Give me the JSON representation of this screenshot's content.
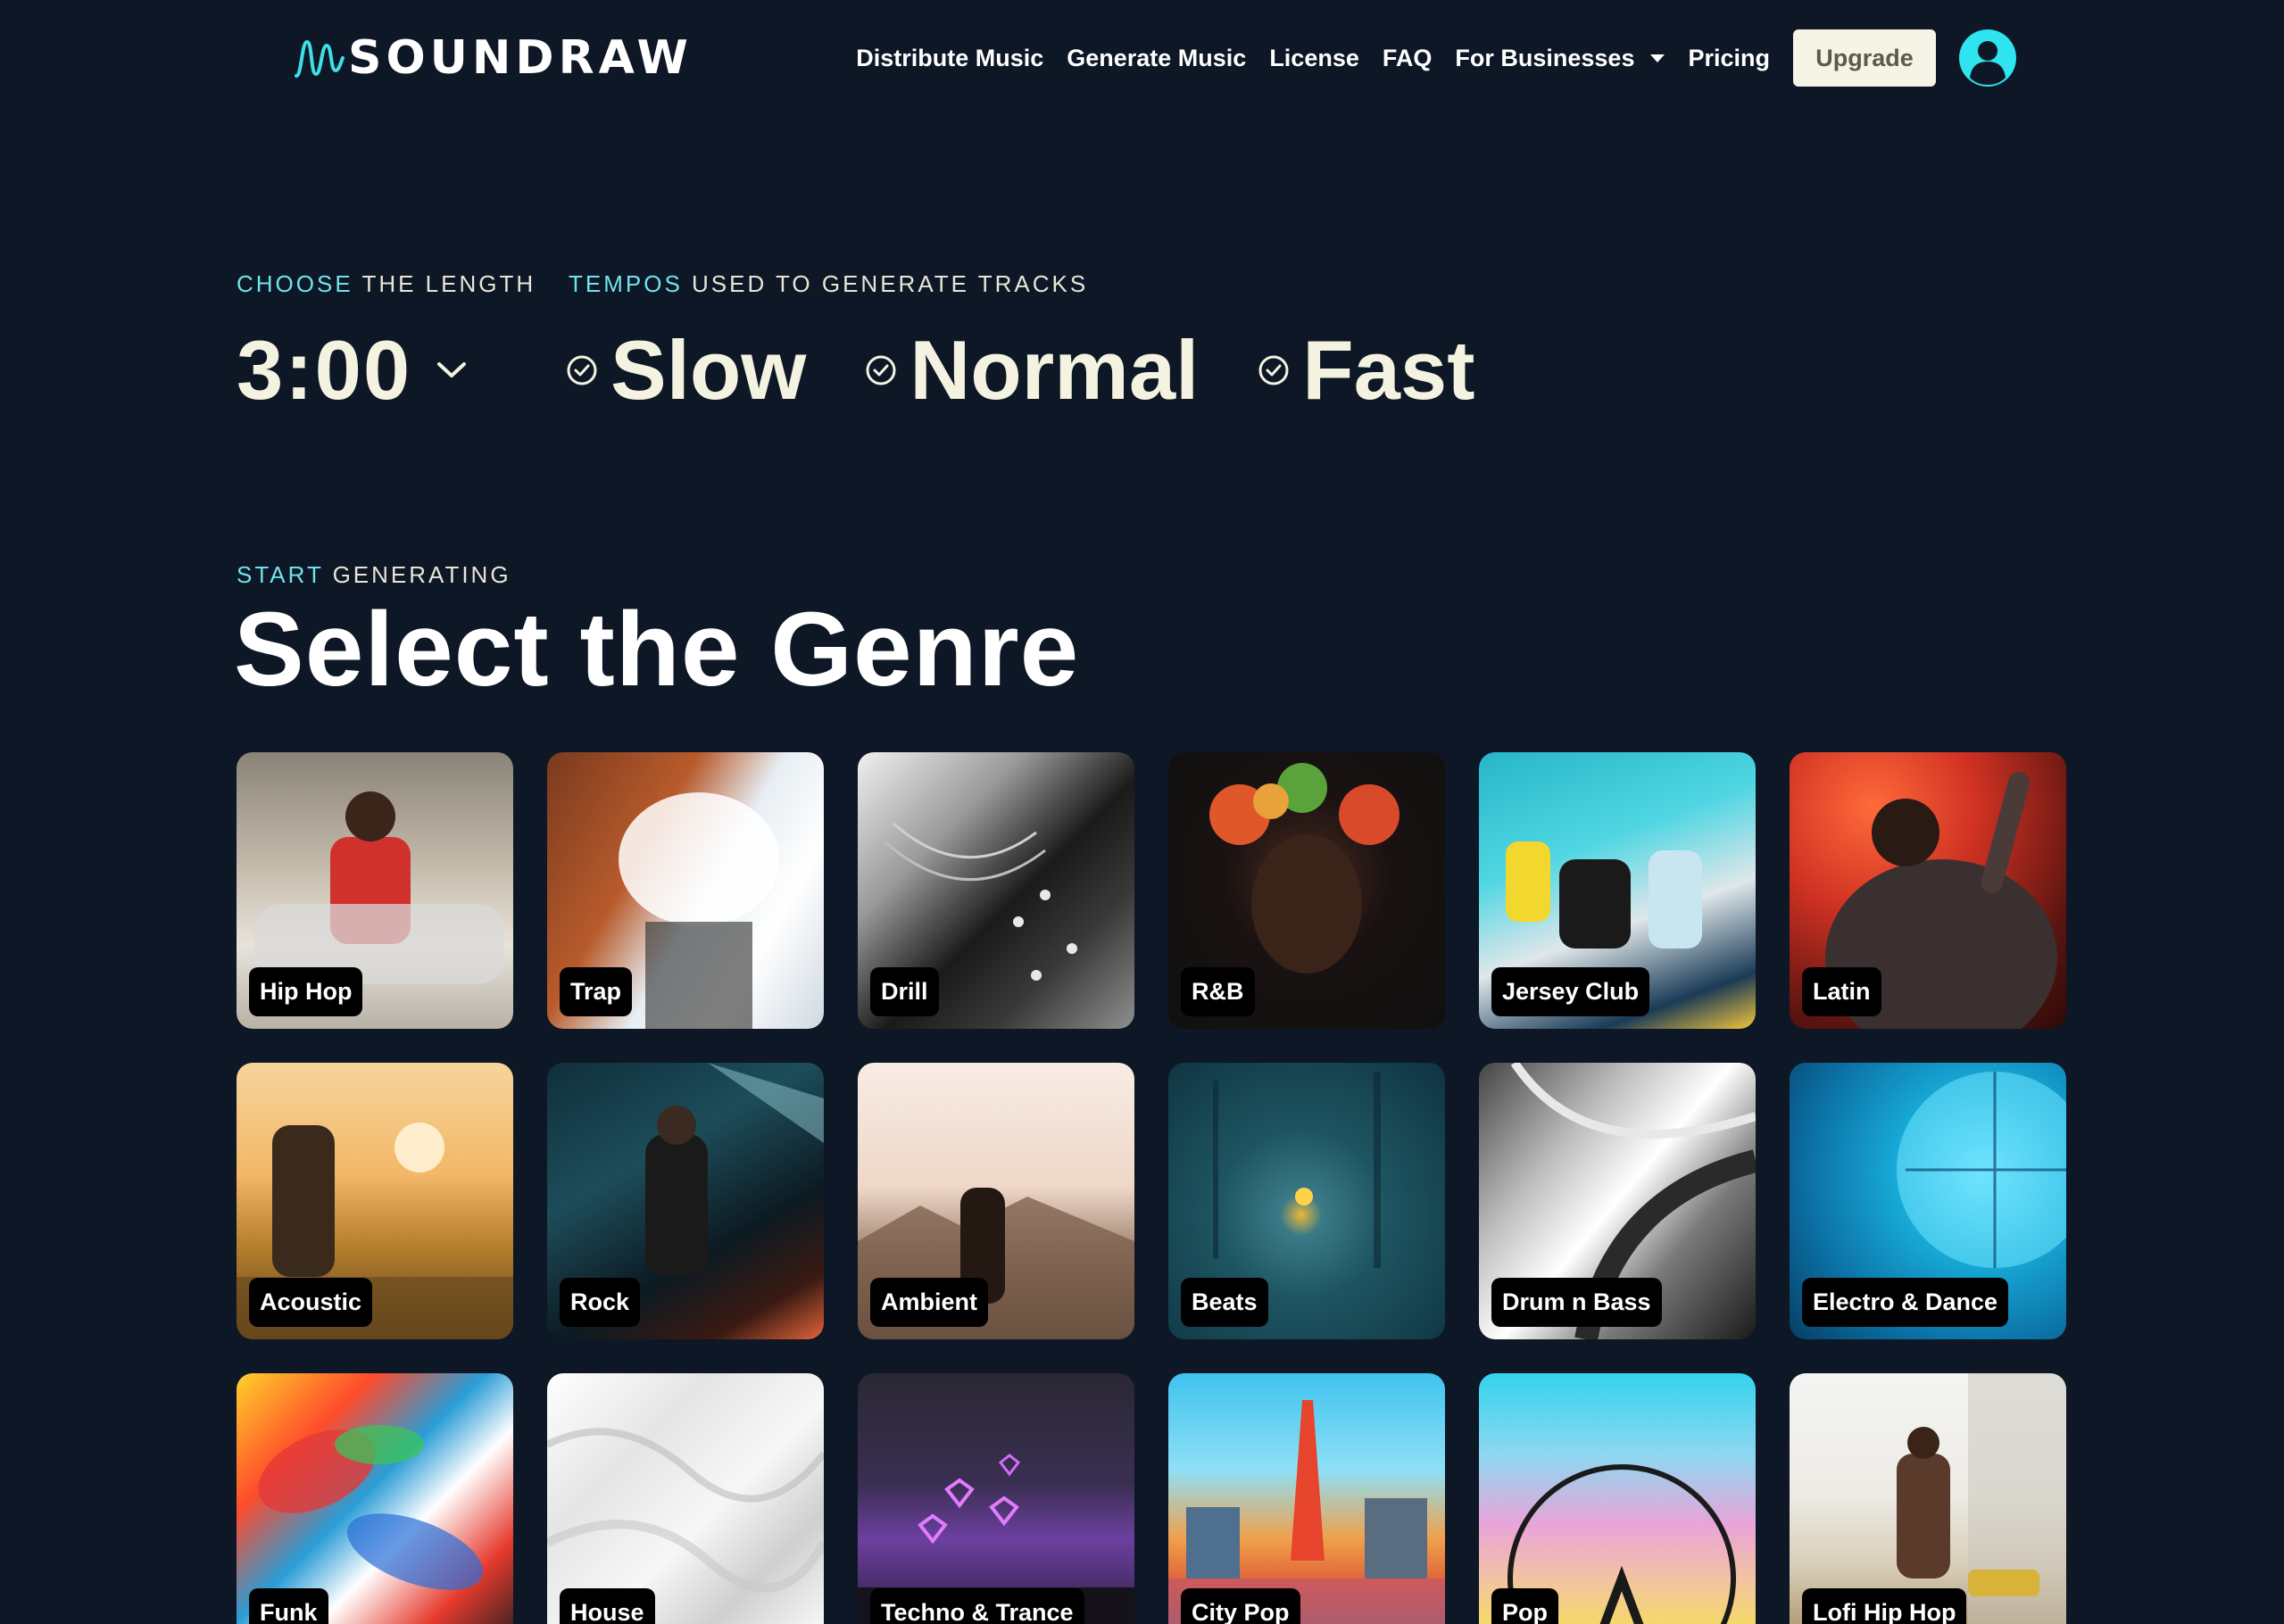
{
  "header": {
    "logo_text": "SOUNDRAW",
    "nav": [
      "Distribute Music",
      "Generate Music",
      "License",
      "FAQ",
      "For Businesses",
      "Pricing"
    ],
    "upgrade_label": "Upgrade"
  },
  "length": {
    "label_accent": "CHOOSE",
    "label_rest": " THE LENGTH",
    "value": "3:00"
  },
  "tempo": {
    "label_accent": "TEMPOS",
    "label_rest": " USED TO GENERATE TRACKS",
    "options": [
      "Slow",
      "Normal",
      "Fast"
    ]
  },
  "genre": {
    "label_accent": "START",
    "label_rest": " GENERATING",
    "title": "Select the Genre",
    "cards": [
      "Hip Hop",
      "Trap",
      "Drill",
      "R&B",
      "Jersey Club",
      "Latin",
      "Acoustic",
      "Rock",
      "Ambient",
      "Beats",
      "Drum n Bass",
      "Electro & Dance",
      "Funk",
      "House",
      "Techno & Trance",
      "City Pop",
      "Pop",
      "Lofi Hip Hop"
    ]
  },
  "colors": {
    "background": "#0d1725",
    "accent": "#6fe3ec",
    "avatar": "#2fe4ee",
    "upgrade_bg": "#f6f4e6"
  }
}
